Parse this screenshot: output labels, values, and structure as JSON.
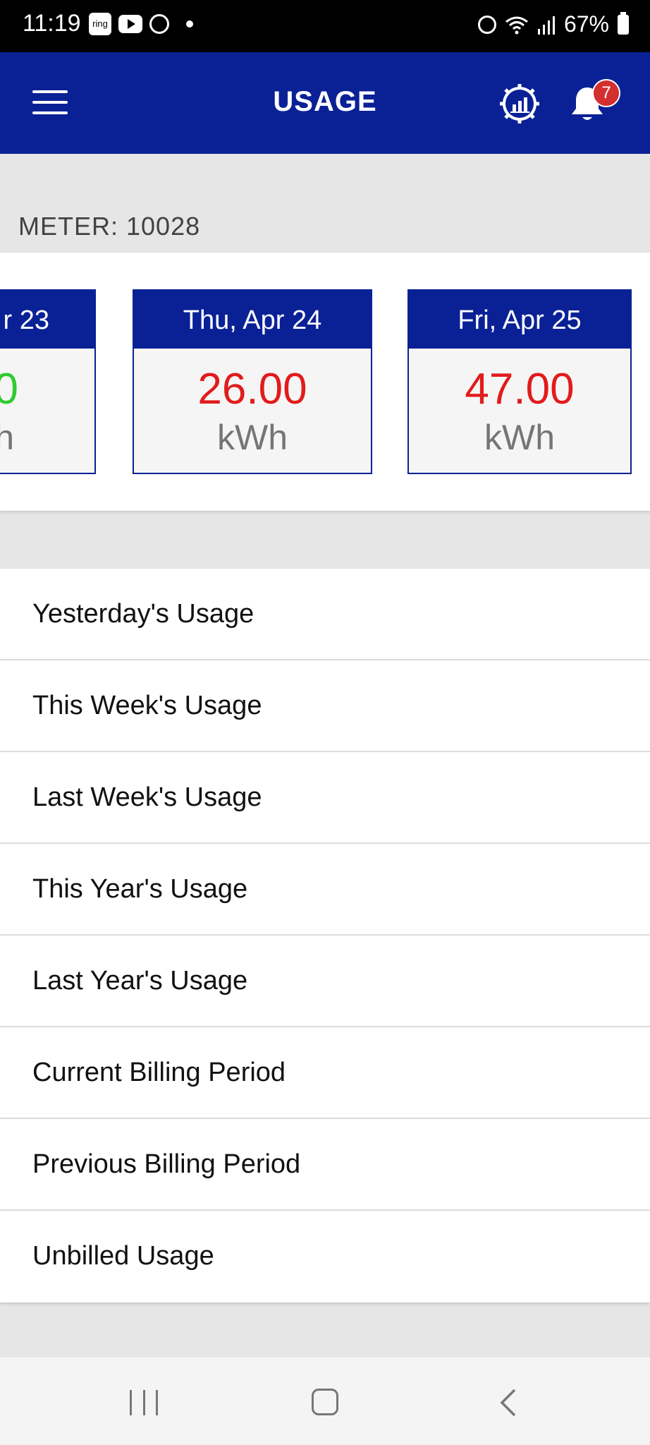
{
  "status_bar": {
    "time": "11:19",
    "ring_label": "ring",
    "battery": "67%"
  },
  "header": {
    "title": "USAGE",
    "notification_count": "7",
    "color": "#0a2196"
  },
  "meter": {
    "label": "METER: 10028"
  },
  "day_cards": [
    {
      "date": "r 23",
      "value": "0",
      "unit": "h",
      "value_color": "#2fcb2f"
    },
    {
      "date": "Thu, Apr 24",
      "value": "26.00",
      "unit": "kWh",
      "value_color": "#e21b1b"
    },
    {
      "date": "Fri, Apr 25",
      "value": "47.00",
      "unit": "kWh",
      "value_color": "#e21b1b"
    }
  ],
  "menu": {
    "items": [
      "Yesterday's Usage",
      "This Week's Usage",
      "Last Week's Usage",
      "This Year's Usage",
      "Last Year's Usage",
      "Current Billing Period",
      "Previous Billing Period",
      "Unbilled Usage"
    ]
  },
  "icons": {
    "menu": "hamburger-icon",
    "analytics": "analytics-gear-icon",
    "notifications": "bell-icon"
  }
}
